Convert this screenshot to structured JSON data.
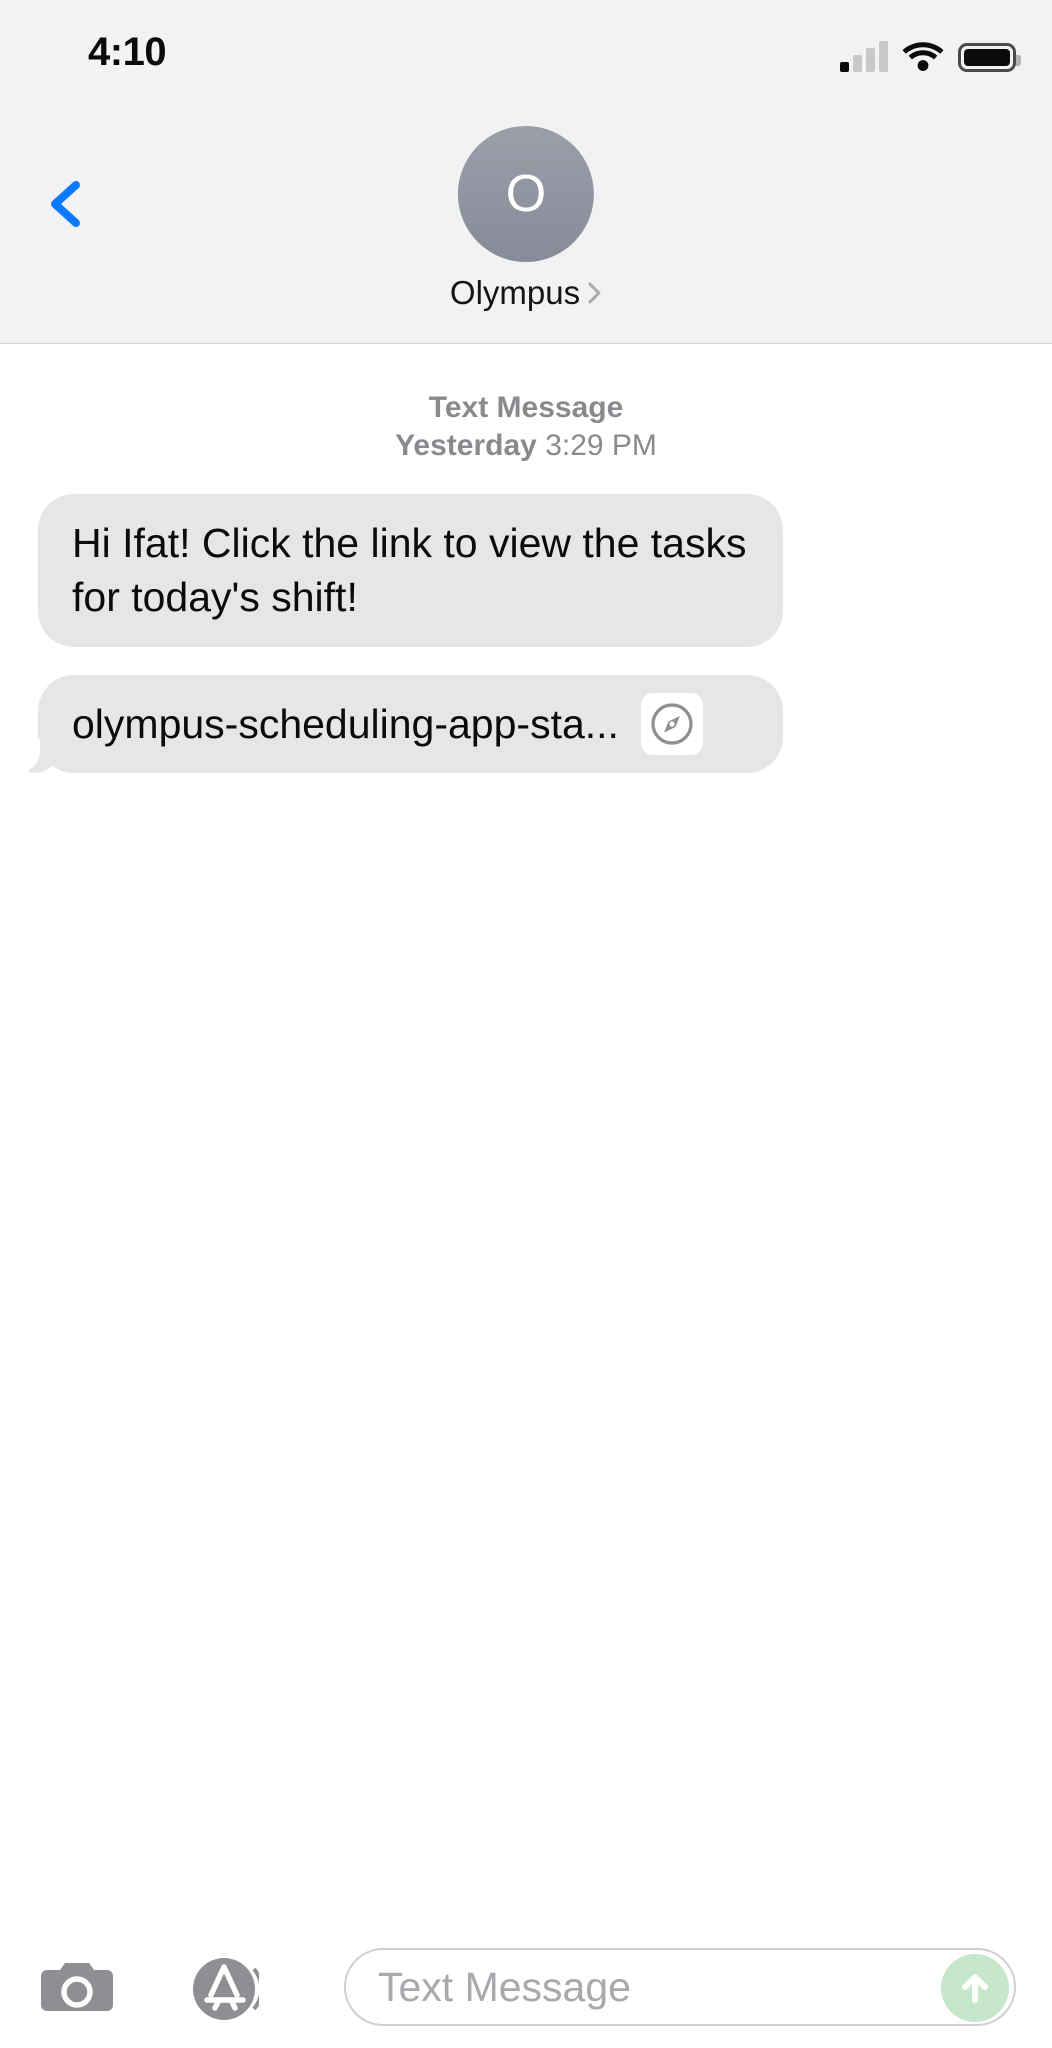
{
  "status_bar": {
    "time": "4:10",
    "signal_icon": "cellular-signal-icon",
    "signal_bars_total": 4,
    "signal_bars_filled": 1,
    "wifi_icon": "wifi-icon",
    "battery_icon": "battery-icon",
    "battery_level_percent": 100
  },
  "nav": {
    "back_icon": "chevron-left-icon",
    "avatar_initial": "O",
    "contact_name": "Olympus",
    "contact_detail_icon": "chevron-right-icon"
  },
  "thread": {
    "timestamp": {
      "kind": "Text Message",
      "day": "Yesterday",
      "time": "3:29 PM"
    },
    "messages": [
      {
        "type": "text",
        "sender": "incoming",
        "text": "Hi Ifat! Click the link to view the tasks for today's shift!"
      },
      {
        "type": "link",
        "sender": "incoming",
        "text": "olympus-scheduling-app-sta...",
        "app_icon": "safari-compass-icon"
      }
    ]
  },
  "toolbar": {
    "camera_icon": "camera-icon",
    "appstore_icon": "app-store-icon",
    "input_placeholder": "Text Message",
    "send_icon": "arrow-up-icon"
  },
  "colors": {
    "header_background": "#f2f2f2",
    "bubble_incoming": "#e6e6e7",
    "accent_blue": "#0a7aff",
    "send_green": "#c7e7cb",
    "secondary_text": "#8a8a8e"
  }
}
